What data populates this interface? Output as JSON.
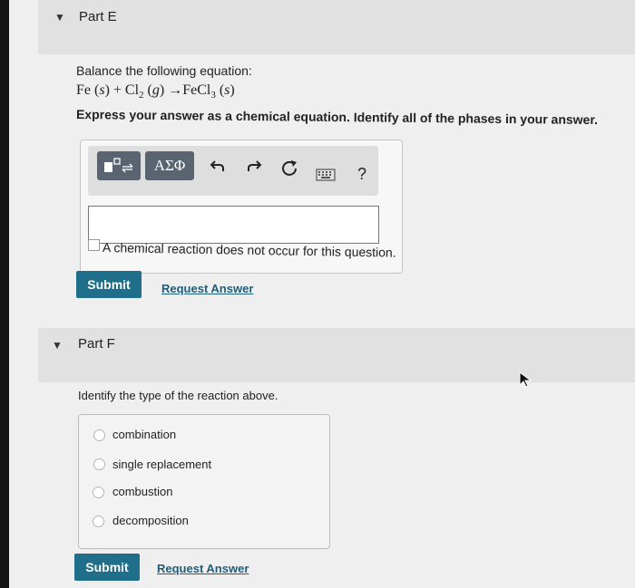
{
  "partE": {
    "title": "Part E",
    "prompt": "Balance the following equation:",
    "instruction": "Express your answer as a chemical equation. Identify all of the phases in your answer.",
    "toolbar": {
      "template_label": "",
      "greek_label": "ΑΣΦ",
      "help_label": "?"
    },
    "answer_value": "",
    "checkbox_label": "A chemical reaction does not occur for this question.",
    "submit_label": "Submit",
    "request_label": "Request Answer"
  },
  "partF": {
    "title": "Part F",
    "prompt": "Identify the type of the reaction above.",
    "choices": [
      {
        "label": "combination"
      },
      {
        "label": "single replacement"
      },
      {
        "label": "combustion"
      },
      {
        "label": "decomposition"
      }
    ],
    "submit_label": "Submit",
    "request_label": "Request Answer"
  },
  "icons": {
    "caret": "caret-down-icon",
    "undo": "undo-icon",
    "redo": "redo-icon",
    "reset": "reset-icon",
    "keyboard": "keyboard-icon",
    "cursor": "mouse-cursor-icon"
  },
  "colors": {
    "submit_bg": "#1f6f8b",
    "link": "#1f5e7a",
    "toolbar_btn": "#5a6370"
  }
}
